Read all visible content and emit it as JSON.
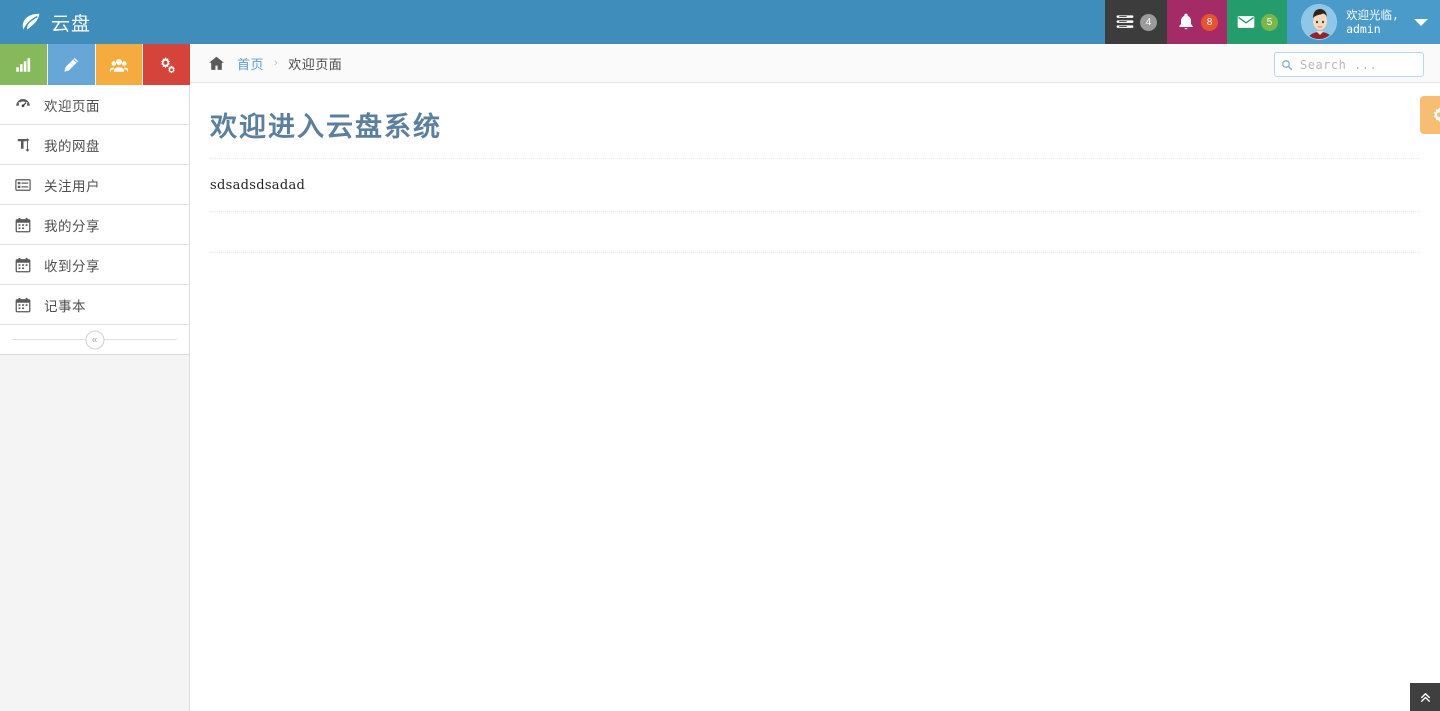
{
  "header": {
    "logo_icon": "leaf-icon",
    "logo_text": "云盘",
    "tasks": {
      "icon": "tasks-icon",
      "badge": "4"
    },
    "notifications": {
      "icon": "bell-icon",
      "badge": "8"
    },
    "messages": {
      "icon": "envelope-icon",
      "badge": "5"
    },
    "user": {
      "greeting": "欢迎光临,\nadmin",
      "avatar": "user-avatar",
      "caret": "chevron-down-icon"
    }
  },
  "sidebar": {
    "quick_actions": [
      {
        "name": "chart-button",
        "icon": "bar-chart-icon",
        "color": "#86b85c"
      },
      {
        "name": "edit-button",
        "icon": "pencil-icon",
        "color": "#67a7d8"
      },
      {
        "name": "users-button",
        "icon": "group-icon",
        "color": "#f5ab3d"
      },
      {
        "name": "settings-button",
        "icon": "cogs-icon",
        "color": "#d4443a"
      }
    ],
    "items": [
      {
        "label": "欢迎页面",
        "icon": "dashboard-icon"
      },
      {
        "label": "我的网盘",
        "icon": "text-height-icon"
      },
      {
        "label": "关注用户",
        "icon": "list-alt-icon"
      },
      {
        "label": "我的分享",
        "icon": "calendar-icon"
      },
      {
        "label": "收到分享",
        "icon": "calendar-icon"
      },
      {
        "label": "记事本",
        "icon": "calendar-icon"
      }
    ],
    "collapse": {
      "icon": "double-chevron-left-icon",
      "glyph": "«"
    }
  },
  "breadcrumb": {
    "home_icon": "home-icon",
    "items": [
      {
        "label": "首页",
        "link": true
      },
      {
        "label": "欢迎页面",
        "link": false
      }
    ],
    "separator": "›"
  },
  "search": {
    "icon": "search-icon",
    "placeholder": "Search ...",
    "value": ""
  },
  "main": {
    "title": "欢迎进入云盘系统",
    "gear_button": {
      "icon": "gear-icon",
      "color": "#f7bd73"
    },
    "body_text": "sdsadsdsadad"
  },
  "scroll_top": {
    "icon": "double-chevron-up-icon",
    "glyph": "«"
  },
  "colors": {
    "header_blue": "#3f8dba",
    "user_blue": "#4a9bc9",
    "tasks_dark": "#3c3c3c",
    "bell_magenta": "#a52b67",
    "mail_green": "#259c6c",
    "title_blue": "#5d7f9e",
    "link_blue": "#5b9bd1"
  }
}
